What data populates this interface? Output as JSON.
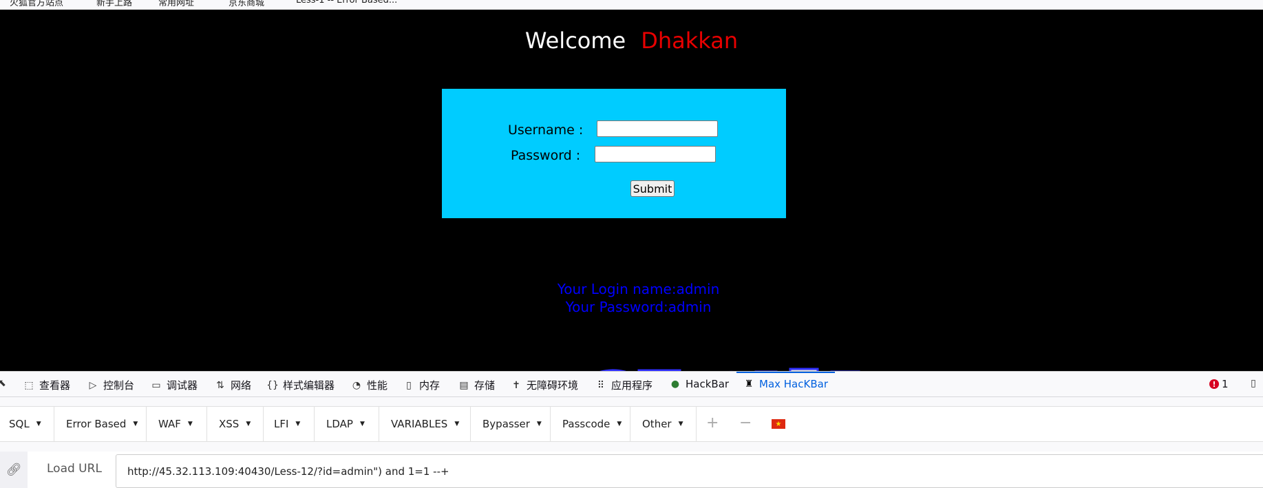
{
  "bookmarks": [
    "火狐官方站点",
    "新手上路",
    "常用网址",
    "京东商城",
    "Less-1 -- Error Based..."
  ],
  "page": {
    "welcome_text": "Welcome",
    "welcome_name": "Dhakkan",
    "username_label": "Username :",
    "password_label": "Password :",
    "submit_label": "Submit",
    "login_name_line": "Your Login name:admin",
    "password_line": "Your Password:admin"
  },
  "devtools": {
    "tabs": [
      {
        "icon": "inspector-icon",
        "label": "查看器"
      },
      {
        "icon": "console-icon",
        "label": "控制台"
      },
      {
        "icon": "debugger-icon",
        "label": "调试器"
      },
      {
        "icon": "network-icon",
        "label": "网络"
      },
      {
        "icon": "style-editor-icon",
        "label": "样式编辑器"
      },
      {
        "icon": "performance-icon",
        "label": "性能"
      },
      {
        "icon": "memory-icon",
        "label": "内存"
      },
      {
        "icon": "storage-icon",
        "label": "存储"
      },
      {
        "icon": "accessibility-icon",
        "label": "无障碍环境"
      },
      {
        "icon": "application-icon",
        "label": "应用程序"
      },
      {
        "icon": "hackbar-icon",
        "label": "HackBar"
      },
      {
        "icon": "max-hackbar-icon",
        "label": "Max HacKBar"
      }
    ],
    "active_tab": "Max HacKBar",
    "error_count": "1"
  },
  "hackbar": {
    "menus": [
      "SQL",
      "Error Based",
      "WAF",
      "XSS",
      "LFI",
      "LDAP",
      "VARIABLES",
      "Bypasser",
      "Passcode",
      "Other"
    ],
    "load_url_label": "Load URL",
    "url_value": "http://45.32.113.109:40430/Less-12/?id=admin\") and 1=1 --+"
  },
  "colors": {
    "page_background": "#000000",
    "login_box": "#00ccff",
    "welcome_name": "#e80000",
    "result_text": "#0000ff",
    "active_tab": "#0060df"
  }
}
